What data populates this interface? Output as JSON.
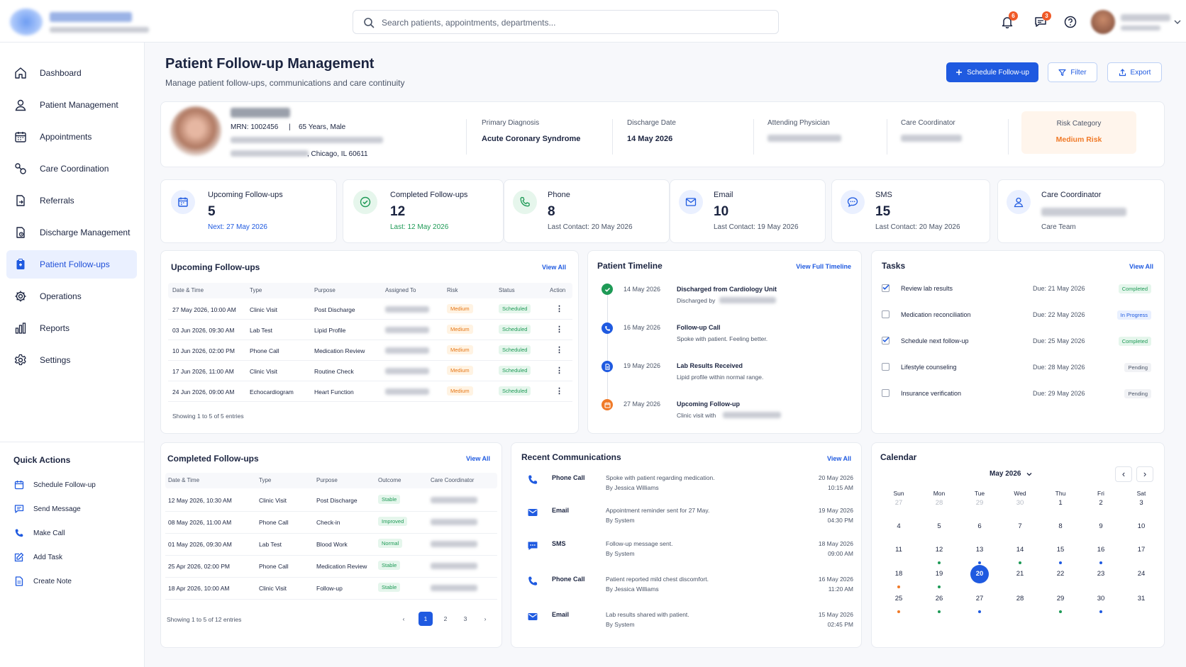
{
  "header": {
    "search_placeholder": "Search patients, appointments, departments...",
    "notif_count": "6",
    "msg_count": "3"
  },
  "sidebar": {
    "items": [
      {
        "label": "Dashboard",
        "icon": "home-icon"
      },
      {
        "label": "Patient Management",
        "icon": "user-icon"
      },
      {
        "label": "Appointments",
        "icon": "calendar-icon"
      },
      {
        "label": "Care Coordination",
        "icon": "link-icon"
      },
      {
        "label": "Referrals",
        "icon": "document-arrow-icon"
      },
      {
        "label": "Discharge Management",
        "icon": "document-exit-icon"
      },
      {
        "label": "Patient Follow-ups",
        "icon": "clipboard-icon",
        "active": true
      },
      {
        "label": "Operations",
        "icon": "cog-icon"
      },
      {
        "label": "Reports",
        "icon": "bar-chart-icon"
      },
      {
        "label": "Settings",
        "icon": "settings-icon"
      }
    ],
    "quick_actions_title": "Quick Actions",
    "quick_actions": [
      "Schedule Follow-up",
      "Send Message",
      "Make Call",
      "Add Task",
      "Create Note"
    ]
  },
  "page": {
    "title": "Patient Follow-up Management",
    "subtitle": "Manage patient follow-ups, communications and care continuity",
    "schedule_btn": "Schedule Follow-up",
    "filter_btn": "Filter",
    "export_btn": "Export"
  },
  "patient": {
    "mrn": "MRN: 1002456",
    "sep": "|",
    "age_sex": "65 Years, Male",
    "city": ", Chicago, IL 60611",
    "primary_diagnosis_label": "Primary Diagnosis",
    "primary_diagnosis": "Acute Coronary Syndrome",
    "discharge_date_label": "Discharge Date",
    "discharge_date": "14 May 2026",
    "attending_label": "Attending Physician",
    "coordinator_label": "Care Coordinator",
    "risk_label": "Risk Category",
    "risk_value": "Medium Risk"
  },
  "stats": [
    {
      "title": "Upcoming Follow-ups",
      "value": "5",
      "sub": "Next: 27 May 2026"
    },
    {
      "title": "Completed Follow-ups",
      "value": "12",
      "sub": "Last: 12 May 2026"
    },
    {
      "title": "Phone",
      "value": "8",
      "sub": "Last Contact: 20 May 2026"
    },
    {
      "title": "Email",
      "value": "10",
      "sub": "Last Contact: 19 May 2026"
    },
    {
      "title": "SMS",
      "value": "15",
      "sub": "Last Contact: 20 May 2026"
    },
    {
      "title": "Care Coordinator",
      "sub": "Care Team"
    }
  ],
  "upcoming": {
    "title": "Upcoming Follow-ups",
    "view_all": "View All",
    "columns": [
      "Date & Time",
      "Type",
      "Purpose",
      "Assigned To",
      "Risk",
      "Status",
      "Action"
    ],
    "rows": [
      {
        "date": "27 May 2026, 10:00 AM",
        "type": "Clinic Visit",
        "purpose": "Post Discharge",
        "risk": "Medium",
        "status": "Scheduled"
      },
      {
        "date": "03 Jun 2026, 09:30 AM",
        "type": "Lab Test",
        "purpose": "Lipid Profile",
        "risk": "Medium",
        "status": "Scheduled"
      },
      {
        "date": "10 Jun 2026, 02:00 PM",
        "type": "Phone Call",
        "purpose": "Medication Review",
        "risk": "Medium",
        "status": "Scheduled"
      },
      {
        "date": "17 Jun 2026, 11:00 AM",
        "type": "Clinic Visit",
        "purpose": "Routine Check",
        "risk": "Medium",
        "status": "Scheduled"
      },
      {
        "date": "24 Jun 2026, 09:00 AM",
        "type": "Echocardiogram",
        "purpose": "Heart Function",
        "risk": "Medium",
        "status": "Scheduled"
      }
    ],
    "footer": "Showing 1 to 5 of 5 entries"
  },
  "timeline": {
    "title": "Patient Timeline",
    "view_all": "View Full Timeline",
    "events": [
      {
        "date": "14 May 2026",
        "title": "Discharged from Cardiology Unit",
        "desc": "Discharged by",
        "color": "#1e9a56"
      },
      {
        "date": "16 May 2026",
        "title": "Follow-up Call",
        "desc": "Spoke with patient. Feeling better.",
        "color": "#1f5ae0"
      },
      {
        "date": "19 May 2026",
        "title": "Lab Results Received",
        "desc": "Lipid profile within normal range.",
        "color": "#1f5ae0"
      },
      {
        "date": "27 May 2026",
        "title": "Upcoming Follow-up",
        "desc": "Clinic visit with",
        "color": "#f07a28"
      }
    ]
  },
  "tasks": {
    "title": "Tasks",
    "view_all": "View All",
    "items": [
      {
        "label": "Review lab results",
        "due": "Due: 21 May 2026",
        "status": "Completed",
        "checked": true
      },
      {
        "label": "Medication reconciliation",
        "due": "Due: 22 May 2026",
        "status": "In Progress",
        "checked": false
      },
      {
        "label": "Schedule next follow-up",
        "due": "Due: 25 May 2026",
        "status": "Completed",
        "checked": true
      },
      {
        "label": "Lifestyle counseling",
        "due": "Due: 28 May 2026",
        "status": "Pending",
        "checked": false
      },
      {
        "label": "Insurance verification",
        "due": "Due: 29 May 2026",
        "status": "Pending",
        "checked": false
      }
    ]
  },
  "completed": {
    "title": "Completed Follow-ups",
    "view_all": "View All",
    "columns": [
      "Date & Time",
      "Type",
      "Purpose",
      "Outcome",
      "Care Coordinator"
    ],
    "rows": [
      {
        "date": "12 May 2026, 10:30 AM",
        "type": "Clinic Visit",
        "purpose": "Post Discharge",
        "outcome": "Stable"
      },
      {
        "date": "08 May 2026, 11:00 AM",
        "type": "Phone Call",
        "purpose": "Check-in",
        "outcome": "Improved"
      },
      {
        "date": "01 May 2026, 09:30 AM",
        "type": "Lab Test",
        "purpose": "Blood Work",
        "outcome": "Normal"
      },
      {
        "date": "25 Apr 2026, 02:00 PM",
        "type": "Phone Call",
        "purpose": "Medication Review",
        "outcome": "Stable"
      },
      {
        "date": "18 Apr 2026, 10:00 AM",
        "type": "Clinic Visit",
        "purpose": "Follow-up",
        "outcome": "Stable"
      }
    ],
    "footer": "Showing 1 to 5 of 12 entries",
    "pages": [
      "1",
      "2",
      "3"
    ]
  },
  "communications": {
    "title": "Recent Communications",
    "view_all": "View All",
    "items": [
      {
        "type": "Phone Call",
        "msg": "Spoke with patient regarding medication.",
        "by": "By Jessica Williams",
        "date": "20 May 2026",
        "time": "10:15 AM",
        "icon": "phone-icon"
      },
      {
        "type": "Email",
        "msg": "Appointment reminder sent for 27 May.",
        "by": "By System",
        "date": "19 May 2026",
        "time": "04:30 PM",
        "icon": "email-icon"
      },
      {
        "type": "SMS",
        "msg": "Follow-up message sent.",
        "by": "By System",
        "date": "18 May 2026",
        "time": "09:00 AM",
        "icon": "sms-icon"
      },
      {
        "type": "Phone Call",
        "msg": "Patient reported mild chest discomfort.",
        "by": "By Jessica Williams",
        "date": "16 May 2026",
        "time": "11:20 AM",
        "icon": "phone-icon"
      },
      {
        "type": "Email",
        "msg": "Lab results shared with patient.",
        "by": "By System",
        "date": "15 May 2026",
        "time": "02:45 PM",
        "icon": "email-icon"
      }
    ]
  },
  "calendar": {
    "title": "Calendar",
    "month": "May 2026",
    "weekdays": [
      "Sun",
      "Mon",
      "Tue",
      "Wed",
      "Thu",
      "Fri",
      "Sat"
    ],
    "weeks": [
      [
        "27",
        "28",
        "29",
        "30",
        "1",
        "2",
        "3"
      ],
      [
        "4",
        "5",
        "6",
        "7",
        "8",
        "9",
        "10"
      ],
      [
        "11",
        "12",
        "13",
        "14",
        "15",
        "16",
        "17"
      ],
      [
        "18",
        "19",
        "20",
        "21",
        "22",
        "23",
        "24"
      ],
      [
        "25",
        "26",
        "27",
        "28",
        "29",
        "30",
        "31"
      ]
    ],
    "muted_first_week": 4,
    "today": "20",
    "dots": {
      "12": "#1e9a56",
      "13": "#1f5ae0",
      "14": "#1e9a56",
      "15": "#1f5ae0",
      "16": "#1f5ae0",
      "18": "#f07a28",
      "19": "#1e9a56",
      "25": "#f07a28",
      "26": "#1e9a56",
      "27": "#1f5ae0",
      "29": "#1e9a56",
      "30": "#1f5ae0"
    }
  },
  "colors": {
    "primary": "#1f5ae0",
    "success": "#1e9a56",
    "warning": "#f07a28",
    "risk_bg": "#fff5ec"
  }
}
